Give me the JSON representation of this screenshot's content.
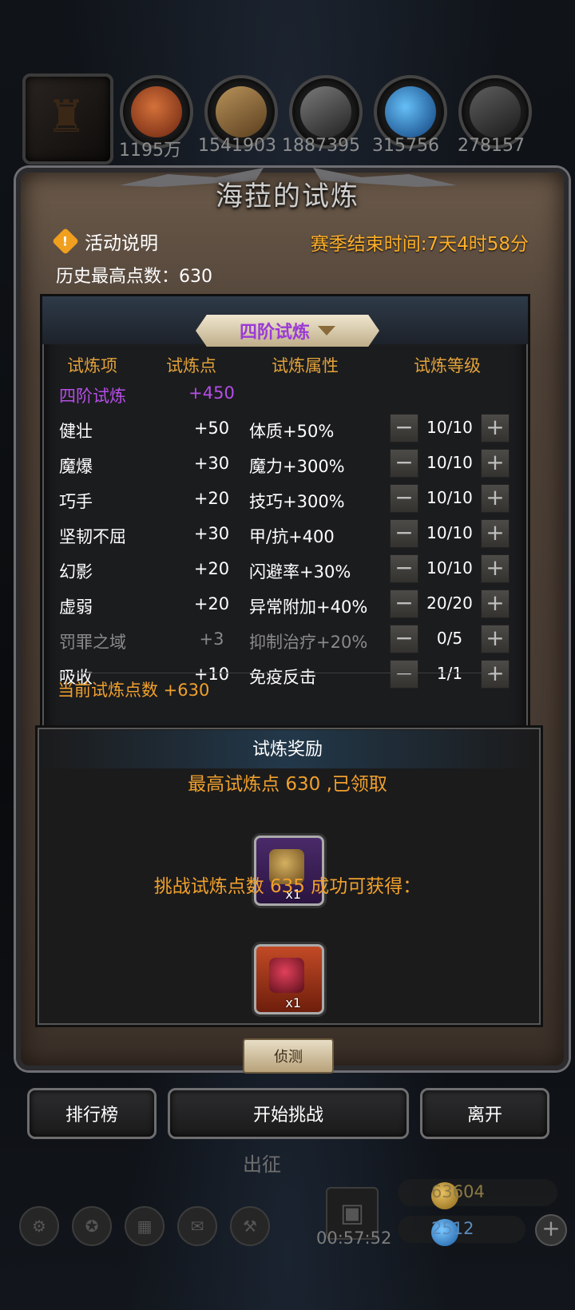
{
  "resources": [
    {
      "icon": "copper-coin-icon",
      "value": "1195万",
      "color": "#c0501e"
    },
    {
      "icon": "wood-plank-icon",
      "value": "1541903",
      "color": "#8d6a3a"
    },
    {
      "icon": "iron-ingot-icon",
      "value": "1887395",
      "color": "#5a5a5a"
    },
    {
      "icon": "blue-crystal-icon",
      "value": "315756",
      "color": "#2a7ad4"
    },
    {
      "icon": "dark-metal-icon",
      "value": "278157",
      "color": "#444444"
    }
  ],
  "title": "海菈的试炼",
  "activity_label": "活动说明",
  "season_end": "赛季结束时间:7天4时58分",
  "best_score": "历史最高点数：630",
  "tier_selector": "四阶试炼",
  "headers": {
    "item": "试炼项",
    "points": "试炼点",
    "attr": "试炼属性",
    "level": "试炼等级"
  },
  "tier_row": {
    "name": "四阶试炼",
    "points": "+450"
  },
  "rows": [
    {
      "name": "健壮",
      "points": "+50",
      "attr": "体质+50%",
      "level": "10/10",
      "dim": false
    },
    {
      "name": "魔爆",
      "points": "+30",
      "attr": "魔力+300%",
      "level": "10/10",
      "dim": false
    },
    {
      "name": "巧手",
      "points": "+20",
      "attr": "技巧+300%",
      "level": "10/10",
      "dim": false
    },
    {
      "name": "坚韧不屈",
      "points": "+30",
      "attr": "甲/抗+400",
      "level": "10/10",
      "dim": false
    },
    {
      "name": "幻影",
      "points": "+20",
      "attr": "闪避率+30%",
      "level": "10/10",
      "dim": false
    },
    {
      "name": "虚弱",
      "points": "+20",
      "attr": "异常附加+40%",
      "level": "20/20",
      "dim": false
    },
    {
      "name": "罚罪之域",
      "points": "+3",
      "attr": "抑制治疗+20%",
      "level": "0/5",
      "dim": true
    },
    {
      "name": "吸收",
      "points": "+10",
      "attr": "免疫反击",
      "level": "1/1",
      "dim": false
    }
  ],
  "current_points": "当前试炼点数 +630",
  "reward": {
    "title": "试炼奖励",
    "claimed": "最高试炼点 630 ,已领取",
    "claimed_item": {
      "icon": "treasure-chest-icon",
      "qty": "x1"
    },
    "next": "挑战试炼点数 635 成功可获得：",
    "next_item": {
      "icon": "red-gem-icon",
      "qty": "x1"
    }
  },
  "detect_label": "侦测",
  "buttons": {
    "ranking": "排行榜",
    "start": "开始挑战",
    "leave": "离开"
  },
  "hud": {
    "expedition": "出征",
    "timer": "00:57:52",
    "gold": "63604",
    "gems": "2512"
  },
  "colors": {
    "accent": "#f0a02c",
    "purple": "#9b3ad6"
  }
}
